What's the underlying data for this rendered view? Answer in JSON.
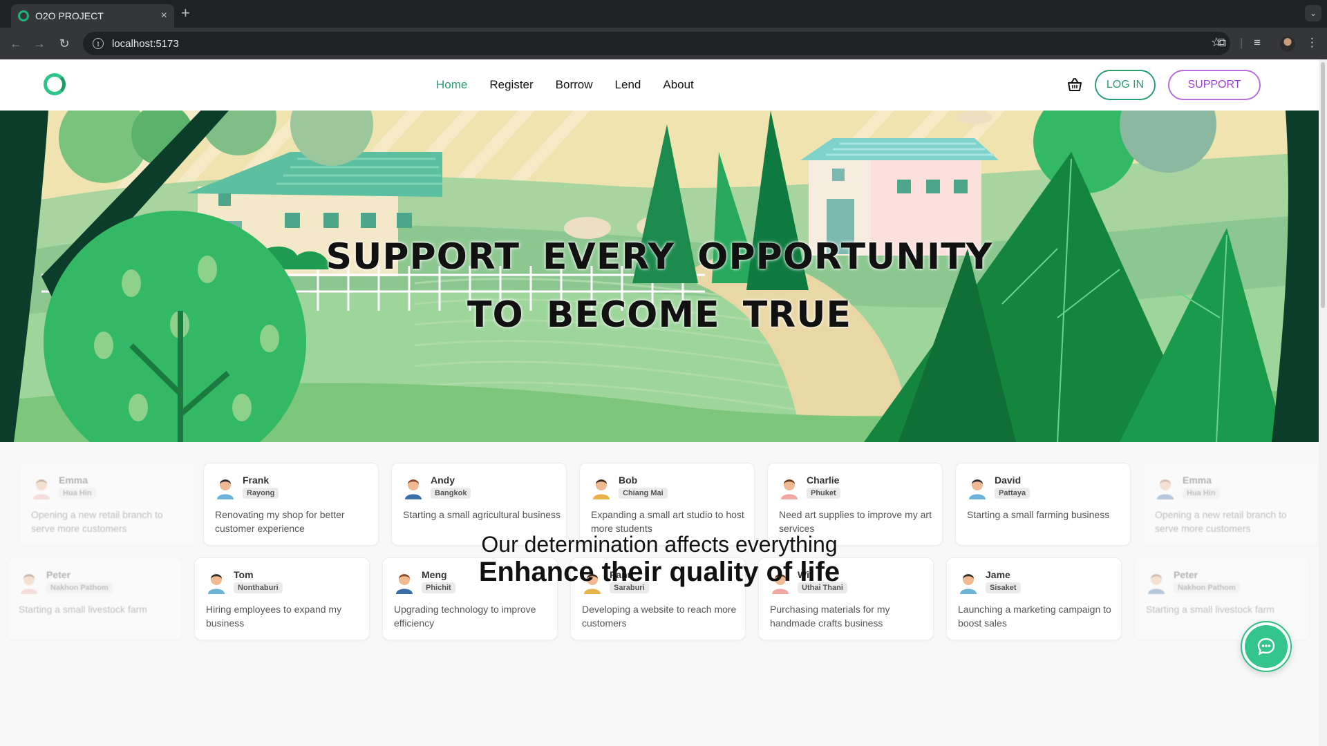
{
  "browser": {
    "tab_title": "O2O PROJECT",
    "tab_close": "×",
    "new_tab": "+",
    "url": "localhost:5173"
  },
  "nav": {
    "links": [
      "Home",
      "Register",
      "Borrow",
      "Lend",
      "About"
    ],
    "active": "Home",
    "login": "LOG IN",
    "support": "SUPPORT"
  },
  "hero": {
    "line1": "SUPPORT EVERY OPPORTUNITY",
    "line2": "TO BECOME TRUE"
  },
  "cards_row1": [
    {
      "name": "Emma",
      "place": "Hua Hin",
      "desc": "Opening a new retail branch to serve more customers",
      "faded": true
    },
    {
      "name": "Frank",
      "place": "Rayong",
      "desc": "Renovating my shop for better customer experience",
      "faded": false
    },
    {
      "name": "Andy",
      "place": "Bangkok",
      "desc": "Starting a small agricultural business",
      "faded": false
    },
    {
      "name": "Bob",
      "place": "Chiang Mai",
      "desc": "Expanding a small art studio to host more students",
      "faded": false
    },
    {
      "name": "Charlie",
      "place": "Phuket",
      "desc": "Need art supplies to improve my art services",
      "faded": false
    },
    {
      "name": "David",
      "place": "Pattaya",
      "desc": "Starting a small farming business",
      "faded": false
    },
    {
      "name": "Emma",
      "place": "Hua Hin",
      "desc": "Opening a new retail branch to serve more customers",
      "faded": true
    }
  ],
  "cards_row2": [
    {
      "name": "Peter",
      "place": "Nakhon Pathom",
      "desc": "Starting a small livestock farm",
      "faded": true
    },
    {
      "name": "Tom",
      "place": "Nonthaburi",
      "desc": "Hiring employees to expand my business",
      "faded": false
    },
    {
      "name": "Meng",
      "place": "Phichit",
      "desc": "Upgrading technology to improve efficiency",
      "faded": false
    },
    {
      "name": "Panu",
      "place": "Saraburi",
      "desc": "Developing a website to reach more customers",
      "faded": false
    },
    {
      "name": "Wit",
      "place": "Uthai Thani",
      "desc": "Purchasing materials for my handmade crafts business",
      "faded": false
    },
    {
      "name": "Jame",
      "place": "Sisaket",
      "desc": "Launching a marketing campaign to boost sales",
      "faded": false
    },
    {
      "name": "Peter",
      "place": "Nakhon Pathom",
      "desc": "Starting a small livestock farm",
      "faded": true
    }
  ],
  "taglines": {
    "line1": "Our determination affects everything",
    "line2": "Enhance their quality of life"
  },
  "colors": {
    "brand_green": "#2a9d6e",
    "support_purple": "#9b3fd0"
  }
}
